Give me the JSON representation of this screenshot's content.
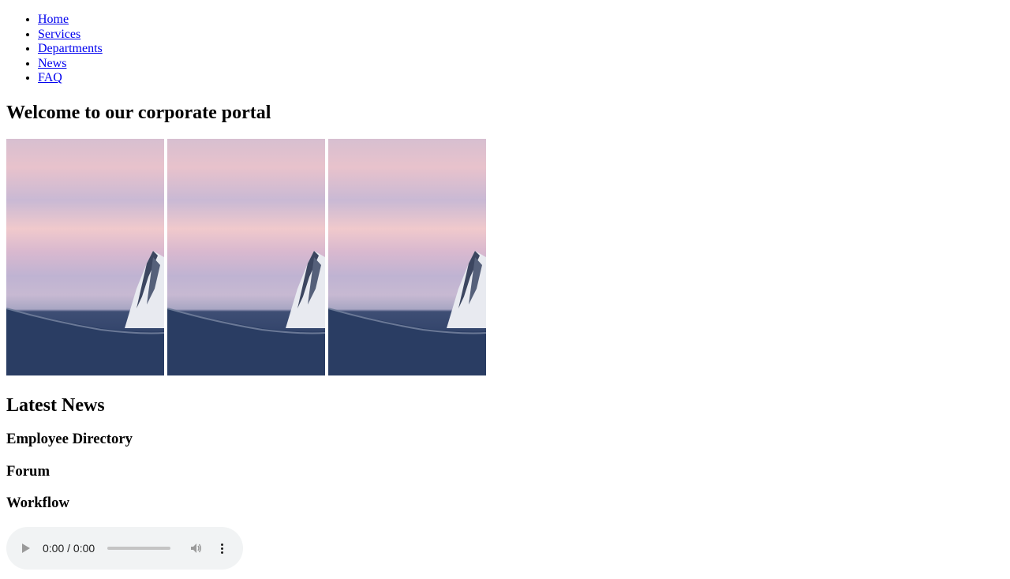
{
  "nav": {
    "items": [
      {
        "label": "Home"
      },
      {
        "label": "Services"
      },
      {
        "label": "Departments"
      },
      {
        "label": "News"
      },
      {
        "label": "FAQ"
      }
    ]
  },
  "welcome": {
    "title": "Welcome to our corporate portal"
  },
  "gallery": {
    "images": [
      {
        "icon": "mountain-sunset-photo"
      },
      {
        "icon": "mountain-sunset-photo"
      },
      {
        "icon": "mountain-sunset-photo"
      }
    ]
  },
  "sections": {
    "latest_news": "Latest News",
    "employee_directory": "Employee Directory",
    "forum": "Forum",
    "workflow": "Workflow"
  },
  "audio": {
    "time": "0:00 / 0:00",
    "progress": 0
  },
  "colors": {
    "link": "#0000ee",
    "audio_bg": "#f1f3f4"
  }
}
